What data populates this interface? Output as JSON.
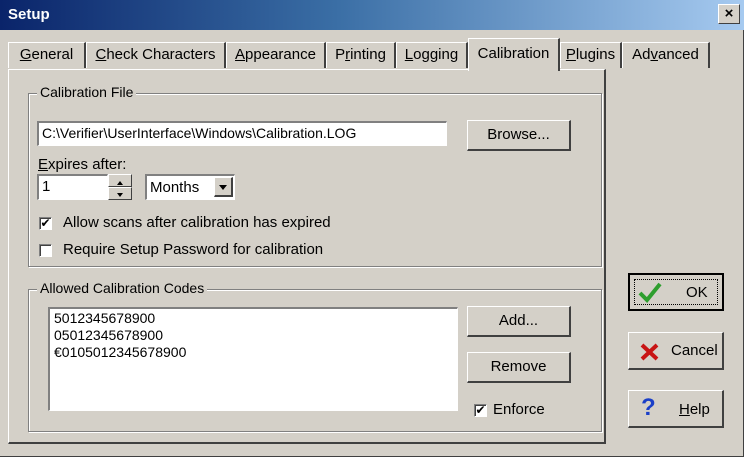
{
  "window": {
    "title": "Setup",
    "close_label": "×"
  },
  "tabs": [
    {
      "label_pre": "",
      "label_u": "G",
      "label_post": "eneral"
    },
    {
      "label_pre": "",
      "label_u": "C",
      "label_post": "heck Characters"
    },
    {
      "label_pre": "",
      "label_u": "A",
      "label_post": "ppearance"
    },
    {
      "label_pre": "P",
      "label_u": "r",
      "label_post": "inting"
    },
    {
      "label_pre": "",
      "label_u": "L",
      "label_post": "ogging"
    },
    {
      "label_pre": "Calibration",
      "label_u": "",
      "label_post": ""
    },
    {
      "label_pre": "",
      "label_u": "P",
      "label_post": "lugins"
    },
    {
      "label_pre": "Ad",
      "label_u": "v",
      "label_post": "anced"
    }
  ],
  "calibration_file": {
    "group_label": "Calibration File",
    "path_value": "C:\\Verifier\\UserInterface\\Windows\\Calibration.LOG",
    "browse_label": "Browse...",
    "expires_label_u": "E",
    "expires_label_post": "xpires after:",
    "expires_value": "1",
    "unit_selected": "Months",
    "allow_scans_label": "Allow scans after calibration has expired",
    "allow_scans_checked": "✔",
    "require_password_label": "Require Setup Password for calibration",
    "require_password_checked": ""
  },
  "allowed_codes": {
    "group_label": "Allowed Calibration Codes",
    "items": [
      "5012345678900",
      "05012345678900",
      "€0105012345678900"
    ],
    "add_label": "Add...",
    "remove_label": "Remove",
    "enforce_label": "Enforce",
    "enforce_checked": "✔"
  },
  "buttons": {
    "ok_label": "OK",
    "cancel_label": "Cancel",
    "help_label_u": "H",
    "help_label_post": "elp"
  },
  "colors": {
    "ok_icon": "#2e9e2e",
    "cancel_icon": "#c81414",
    "help_icon": "#1a3fc8"
  }
}
